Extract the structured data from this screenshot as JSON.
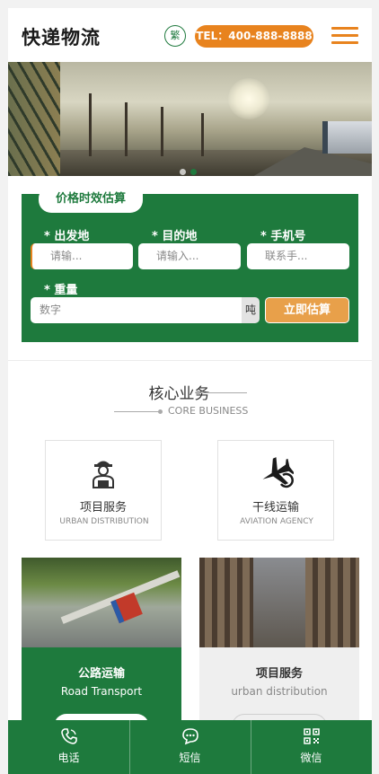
{
  "header": {
    "logo": "快递物流",
    "lang_label": "繁",
    "tel": "TEL：400-888-8888",
    "menu_icon": "hamburger-menu-icon"
  },
  "banner": {
    "slide_count": 2,
    "active_slide": 2
  },
  "estimate": {
    "tab_label": "价格时效估算",
    "fields": [
      {
        "label": "* 出发地",
        "placeholder": "请输..."
      },
      {
        "label": "* 目的地",
        "placeholder": "请输入..."
      },
      {
        "label": "* 手机号",
        "placeholder": "联系手..."
      },
      {
        "label": "* 重量",
        "placeholder": "数字"
      }
    ],
    "weight_unit": "吨",
    "submit_label": "立即估算"
  },
  "core": {
    "title": "核心业务",
    "subtitle": "CORE BUSINESS",
    "services": [
      {
        "name": "项目服务",
        "en": "URBAN DISTRIBUTION",
        "icon": "worker-icon"
      },
      {
        "name": "干线运输",
        "en": "AVIATION AGENCY",
        "icon": "airplane-icon"
      }
    ]
  },
  "features": [
    {
      "title": "公路运输",
      "en": "Road Transport"
    },
    {
      "title": "项目服务",
      "en": "urban distribution"
    }
  ],
  "bottom_bar": [
    {
      "label": "电话",
      "icon": "phone-icon"
    },
    {
      "label": "短信",
      "icon": "message-icon"
    },
    {
      "label": "微信",
      "icon": "qrcode-icon"
    }
  ],
  "colors": {
    "brand_green": "#1e7a3d",
    "accent_orange": "#e8831e"
  }
}
